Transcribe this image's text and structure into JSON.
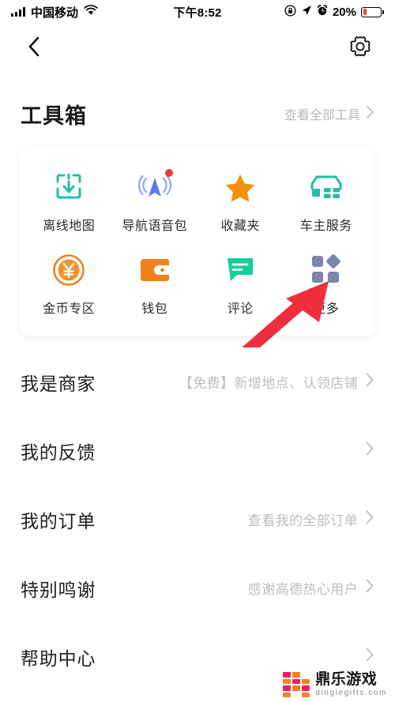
{
  "status_bar": {
    "signal_icon": "signal-bars-icon",
    "carrier": "中国移动",
    "wifi_icon": "wifi-icon",
    "time": "下午8:52",
    "rotation_lock_icon": "rotation-lock-icon",
    "location_icon": "location-arrow-icon",
    "alarm_icon": "alarm-clock-icon",
    "battery_percent": "20%",
    "battery_level": 20,
    "battery_color": "#f43f3f"
  },
  "navbar": {
    "back_icon": "chevron-left-icon",
    "settings_icon": "gear-icon"
  },
  "toolbox": {
    "title": "工具箱",
    "more_link": "查看全部工具",
    "more_chevron": "chevron-right-icon",
    "items": [
      {
        "label": "离线地图",
        "icon": "offline-map-download-icon",
        "color": "#2bbba3",
        "badge": false
      },
      {
        "label": "导航语音包",
        "icon": "navigation-voice-icon",
        "color": "#5b7cf0",
        "badge": true
      },
      {
        "label": "收藏夹",
        "icon": "star-icon",
        "color": "#f5900a",
        "badge": false
      },
      {
        "label": "车主服务",
        "icon": "car-service-icon",
        "color": "#2bbba3",
        "badge": false
      },
      {
        "label": "金币专区",
        "icon": "gold-coin-yuan-icon",
        "color": "#f0821e",
        "badge": false
      },
      {
        "label": "钱包",
        "icon": "wallet-icon",
        "color": "#f0821e",
        "badge": false
      },
      {
        "label": "评论",
        "icon": "comment-bubble-icon",
        "color": "#13c островcf",
        "badge": false
      },
      {
        "label": "更多",
        "icon": "more-grid-icon",
        "color": "#7b86ad",
        "badge": false
      }
    ]
  },
  "annotation": {
    "arrow_icon": "red-arrow-pointer",
    "color": "#ee2e3c",
    "points_to": "更多"
  },
  "menu": {
    "rows": [
      {
        "title": "我是商家",
        "hint": "【免费】新增地点、认领店铺",
        "chevron": "chevron-right-icon"
      },
      {
        "title": "我的反馈",
        "hint": "",
        "chevron": "chevron-right-icon"
      },
      {
        "title": "我的订单",
        "hint": "查看我的全部订单",
        "chevron": "chevron-right-icon"
      },
      {
        "title": "特别鸣谢",
        "hint": "感谢高德热心用户",
        "chevron": "chevron-right-icon"
      },
      {
        "title": "帮助中心",
        "hint": "",
        "chevron": "chevron-right-icon"
      }
    ]
  },
  "watermark": {
    "brand_cn": "鼎乐游戏",
    "brand_url": "dinglegifts.com",
    "colors": {
      "orange": "#f5821f",
      "pink": "#ec1e63"
    }
  }
}
